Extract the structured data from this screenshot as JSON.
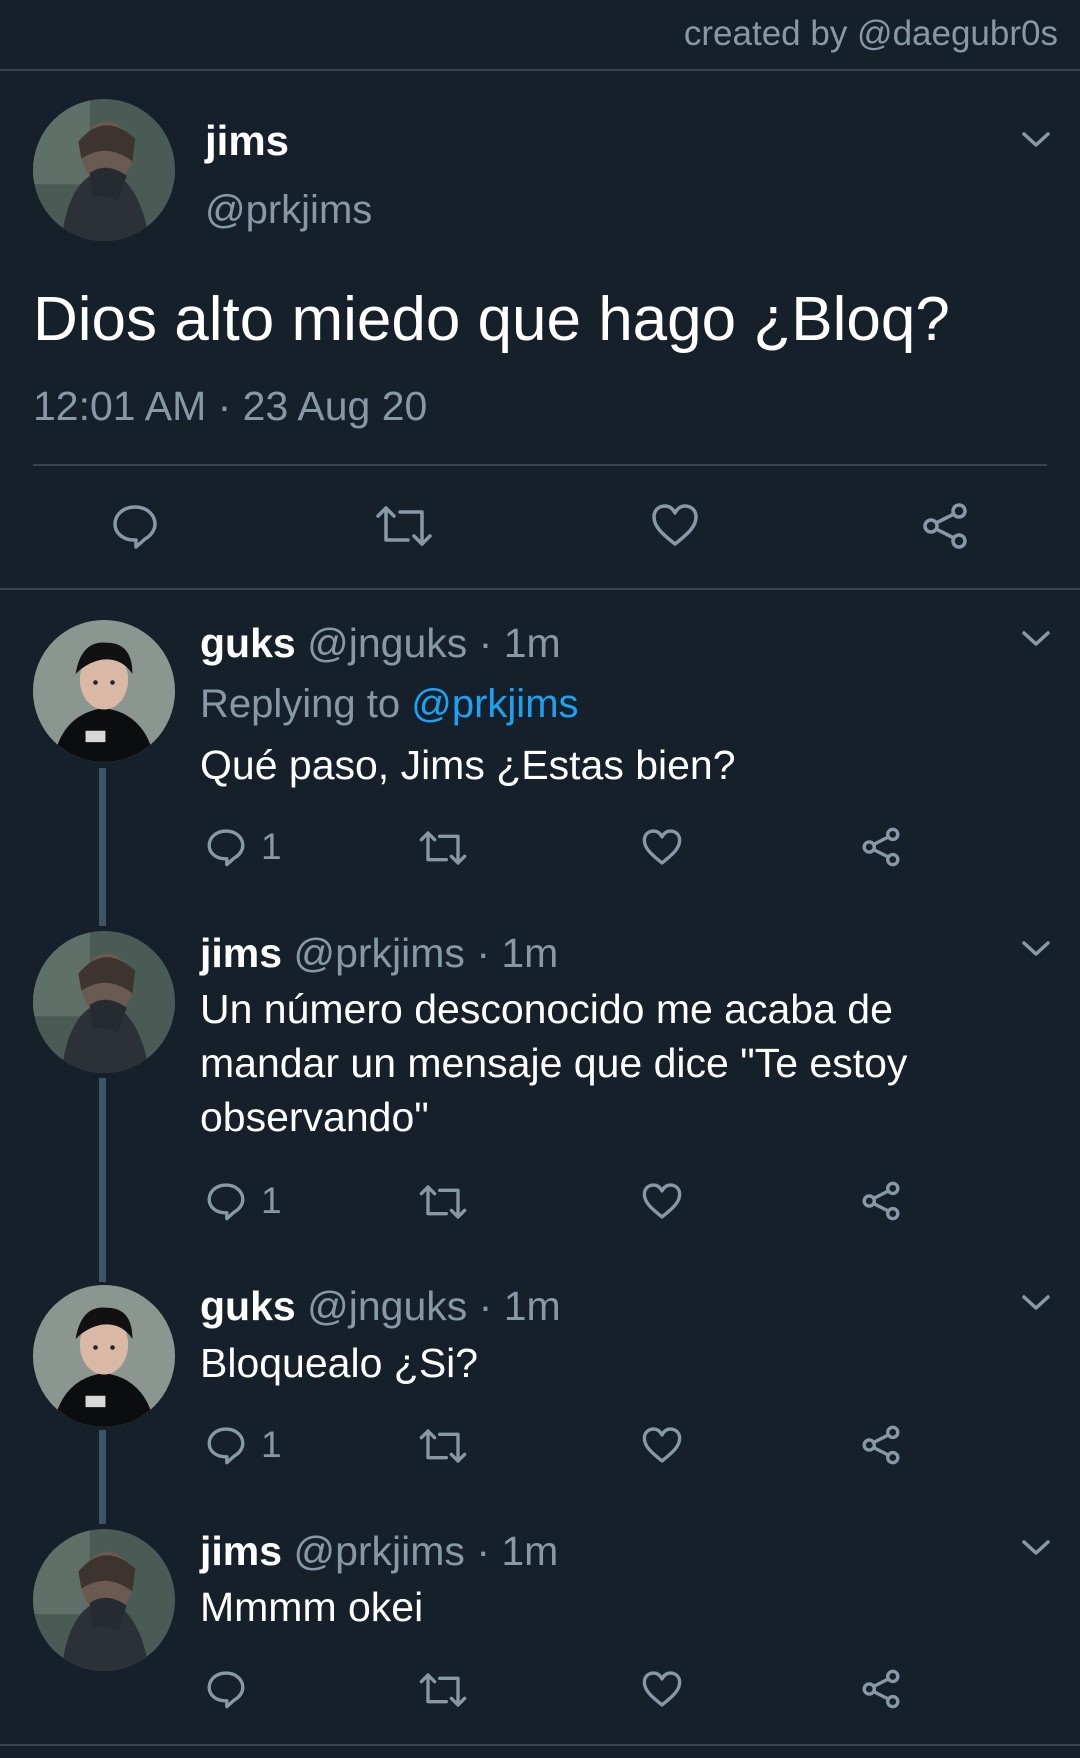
{
  "watermark": "created by @daegubr0s",
  "main_tweet": {
    "name": "jims",
    "handle": "@prkjims",
    "text": "Dios alto miedo que hago ¿Bloq?",
    "timestamp": "12:01 AM · 23 Aug 20",
    "icons": [
      "reply-icon",
      "retweet-icon",
      "like-icon",
      "share-icon"
    ]
  },
  "replies": [
    {
      "name": "guks",
      "handle": "@jnguks",
      "time": "· 1m",
      "replying_prefix": "Replying to",
      "replying_mention": "@prkjims",
      "text": "Qué paso, Jims ¿Estas bien?",
      "reply_count": "1"
    },
    {
      "name": "jims",
      "handle": "@prkjims",
      "time": "· 1m",
      "text": "Un número desconocido me acaba de mandar un mensaje que dice \"Te estoy observando\"",
      "reply_count": "1"
    },
    {
      "name": "guks",
      "handle": "@jnguks",
      "time": "· 1m",
      "text": "Bloquealo ¿Si?",
      "reply_count": "1"
    },
    {
      "name": "jims",
      "handle": "@prkjims",
      "time": "· 1m",
      "text": "Mmmm okei",
      "reply_count": ""
    }
  ],
  "colors": {
    "background": "#15202b",
    "secondary_text": "#8899a6",
    "link": "#1da1f2",
    "divider": "#38444d",
    "thread_line": "#3d5466"
  }
}
